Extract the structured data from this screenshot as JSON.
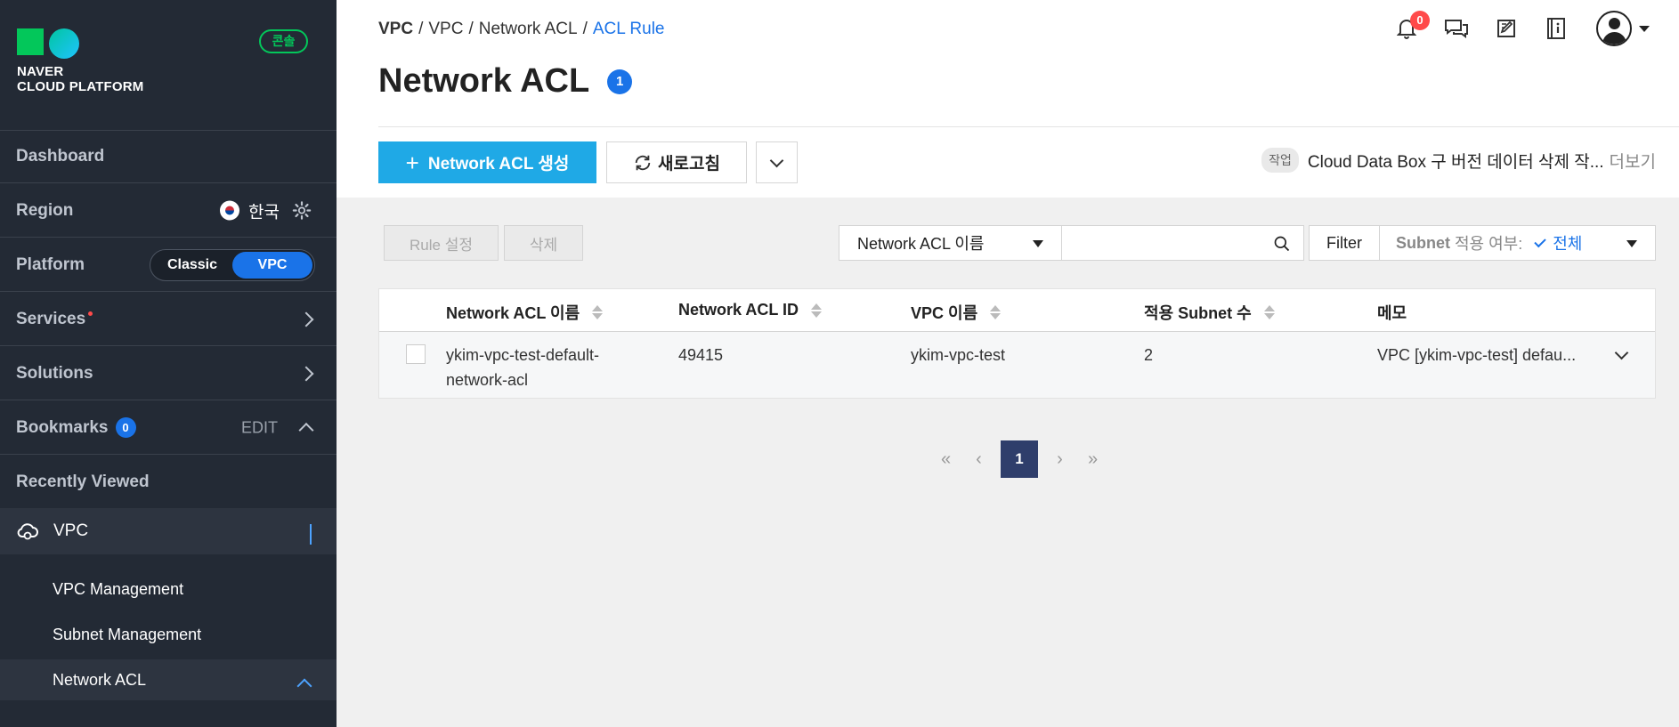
{
  "sidebar": {
    "brand_line1": "NAVER",
    "brand_line2": "CLOUD PLATFORM",
    "console_label": "콘솔",
    "dashboard": "Dashboard",
    "region_label": "Region",
    "region_value": "한국",
    "platform_label": "Platform",
    "platform_options": [
      "Classic",
      "VPC"
    ],
    "platform_selected": "VPC",
    "services": "Services",
    "solutions": "Solutions",
    "bookmarks": "Bookmarks",
    "bookmarks_count": "0",
    "edit": "EDIT",
    "recently_viewed": "Recently Viewed",
    "vpc": "VPC",
    "sub_items": [
      "VPC Management",
      "Subnet Management",
      "Network ACL"
    ]
  },
  "header": {
    "breadcrumb": [
      "VPC",
      "VPC",
      "Network ACL",
      "ACL Rule"
    ],
    "title": "Network ACL",
    "title_count": "1",
    "notification_count": "0",
    "create_button": "Network ACL 생성",
    "refresh_button": "새로고침",
    "task_tag": "작업",
    "task_text": "Cloud Data Box 구 버전 데이터 삭제 작...",
    "task_more": "더보기"
  },
  "toolbar": {
    "rule_button": "Rule 설정",
    "delete_button": "삭제",
    "search_field_select": "Network ACL 이름",
    "search_placeholder": "",
    "filter_label": "Filter",
    "subnet_filter_bold": "Subnet",
    "subnet_filter_text": "적용 여부:",
    "subnet_filter_value": "전체"
  },
  "table": {
    "columns": [
      "Network ACL 이름",
      "Network ACL ID",
      "VPC 이름",
      "적용 Subnet 수",
      "메모"
    ],
    "rows": [
      {
        "name_line1": "ykim-vpc-test-default-",
        "name_line2": "network-acl",
        "id": "49415",
        "vpc": "ykim-vpc-test",
        "subnet_count": "2",
        "memo": "VPC [ykim-vpc-test] defau..."
      }
    ]
  },
  "pagination": {
    "current": "1"
  },
  "colors": {
    "accent": "#1a73e8",
    "create_button": "#1fa9e6",
    "sidebar_bg": "#232a35",
    "brand_green": "#03c75a",
    "pager_active": "#2f3e6b"
  }
}
